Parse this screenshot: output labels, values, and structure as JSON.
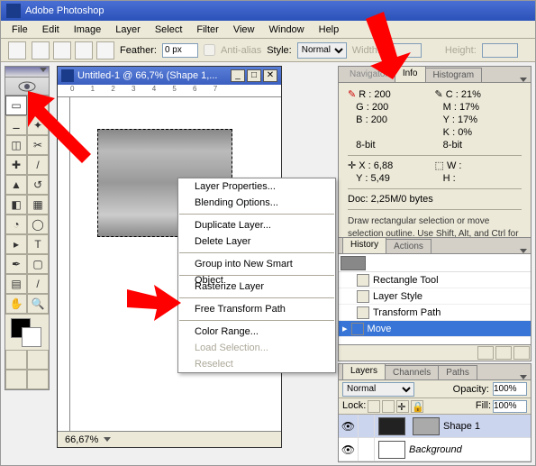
{
  "app": {
    "title": "Adobe Photoshop"
  },
  "menu": [
    "File",
    "Edit",
    "Image",
    "Layer",
    "Select",
    "Filter",
    "View",
    "Window",
    "Help"
  ],
  "options": {
    "feather_label": "Feather:",
    "feather_value": "0 px",
    "antialias": "Anti-alias",
    "style_label": "Style:",
    "style_value": "Normal",
    "width_label": "Width:",
    "height_label": "Height:"
  },
  "doc": {
    "title": "Untitled-1 @ 66,7% (Shape 1,...",
    "zoom": "66,67%"
  },
  "info_tabs": {
    "a": "Navigator",
    "b": "Info",
    "c": "Histogram"
  },
  "info": {
    "r": "R :",
    "rv": "200",
    "c": "C :",
    "cv": "21%",
    "g": "G :",
    "gv": "200",
    "m": "M :",
    "mv": "17%",
    "b": "B :",
    "bv": "200",
    "y": "Y :",
    "yv": "17%",
    "k": "K :",
    "kv": "0%",
    "bit1": "8-bit",
    "bit2": "8-bit",
    "x": "X :",
    "xv": "6,88",
    "w": "W :",
    "yy": "Y :",
    "yyv": "5,49",
    "h": "H :",
    "docsize": "Doc: 2,25M/0 bytes",
    "hint": "Draw rectangular selection or move selection outline. Use Shift, Alt, and Ctrl for additional options."
  },
  "hist_tabs": {
    "a": "History",
    "b": "Actions"
  },
  "history": [
    {
      "label": "Rectangle Tool"
    },
    {
      "label": "Layer Style"
    },
    {
      "label": "Transform Path"
    },
    {
      "label": "Move"
    }
  ],
  "layers_tabs": {
    "a": "Layers",
    "b": "Channels",
    "c": "Paths"
  },
  "layers": {
    "mode": "Normal",
    "opacity_label": "Opacity:",
    "opacity": "100%",
    "lock": "Lock:",
    "fill_label": "Fill:",
    "fill": "100%",
    "items": [
      {
        "name": "Shape 1"
      },
      {
        "name": "Background"
      }
    ]
  },
  "ctx": [
    {
      "t": "Layer Properties..."
    },
    {
      "t": "Blending Options..."
    },
    {
      "sep": 1
    },
    {
      "t": "Duplicate Layer..."
    },
    {
      "t": "Delete Layer"
    },
    {
      "sep": 1
    },
    {
      "t": "Group into New Smart Object"
    },
    {
      "sep": 1
    },
    {
      "t": "Rasterize Layer"
    },
    {
      "sep": 1
    },
    {
      "t": "Free Transform Path"
    },
    {
      "sep": 1
    },
    {
      "t": "Color Range..."
    },
    {
      "t": "Load Selection...",
      "d": 1
    },
    {
      "t": "Reselect",
      "d": 1
    }
  ]
}
